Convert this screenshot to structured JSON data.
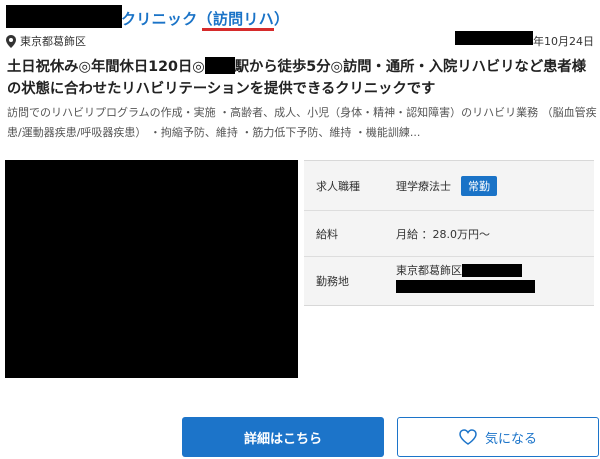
{
  "listing": {
    "title_suffix": "クリニック",
    "title_tag": "（訪問リハ）",
    "location": "東京都葛飾区",
    "date": "年10月24日",
    "headline_part1": "土日祝休み◎年間休日120日◎",
    "headline_part2": "駅から徒歩5分◎訪問・通所・入院リハビリなど患者様の状態に合わせたリハビリテーションを提供できるクリニックです",
    "description": "訪問でのリハビリプログラムの作成・実施 ・高齢者、成人、小児（身体・精神・認知障害）のリハビリ業務 （脳血管疾患/運動器疾患/呼吸器疾患） ・拘縮予防、維持 ・筋力低下予防、維持 ・機能訓練..."
  },
  "info": {
    "rows": [
      {
        "label": "求人職種",
        "value": "理学療法士",
        "badge": "常勤"
      },
      {
        "label": "給料",
        "value": "月給 ：28.0万円〜"
      },
      {
        "label": "勤務地",
        "value": "東京都葛飾区"
      }
    ]
  },
  "buttons": {
    "detail": "詳細はこちら",
    "favorite": "気になる"
  },
  "colors": {
    "accent": "#1c74c9",
    "underline": "#d62b2b",
    "redaction": "#000000"
  },
  "icons": {
    "location": "map-pin-icon",
    "favorite": "heart-icon"
  }
}
